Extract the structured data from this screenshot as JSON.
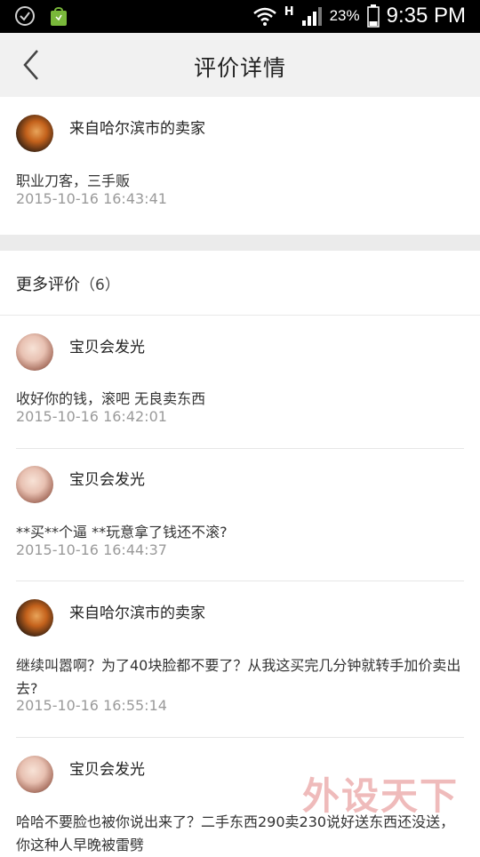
{
  "status_bar": {
    "battery": "23%",
    "time": "9:35 PM",
    "network": "H"
  },
  "header": {
    "title": "评价详情"
  },
  "main_review": {
    "author": "来自哈尔滨市的卖家",
    "text": "职业刀客，三手贩",
    "time": "2015-10-16 16:43:41"
  },
  "more_reviews": {
    "title": "更多评价",
    "count": "（6）",
    "items": [
      {
        "author": "宝贝会发光",
        "text": "收好你的钱，滚吧 无良卖东西",
        "time": "2015-10-16 16:42:01"
      },
      {
        "author": "宝贝会发光",
        "text": "**买**个逼 **玩意拿了钱还不滚?",
        "time": "2015-10-16 16:44:37"
      },
      {
        "author": "来自哈尔滨市的卖家",
        "text": "继续叫嚣啊？为了40块脸都不要了？从我这买完几分钟就转手加价卖出去?",
        "time": "2015-10-16 16:55:14"
      },
      {
        "author": "宝贝会发光",
        "text": "哈哈不要脸也被你说出来了？二手东西290卖230说好送东西还没送，你这种人早晚被雷劈",
        "time": ""
      }
    ]
  },
  "watermark": "外设天下"
}
